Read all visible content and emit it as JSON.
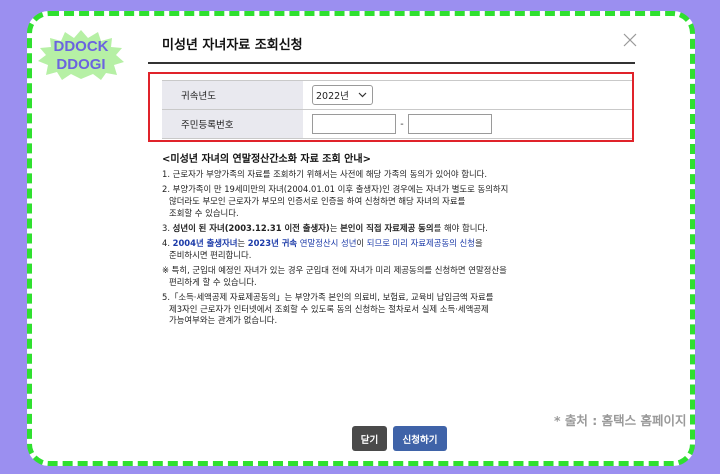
{
  "logo": {
    "line1": "DDOCK",
    "line2": "DDOGI"
  },
  "dialog": {
    "title": "미성년 자녀자료 조회신청",
    "close_icon": "close-icon"
  },
  "form": {
    "year_label": "귀속년도",
    "year_value": "2022년",
    "rrn_label": "주민등록번호",
    "rrn_front": "",
    "rrn_back": "",
    "rrn_separator": "-"
  },
  "info": {
    "heading": "<미성년 자녀의 연말정산간소화 자료 조회 안내>",
    "n1": "1. 근로자가 부양가족의 자료를 조회하기 위해서는 사전에 해당 가족의 동의가 있어야 합니다.",
    "n2a": "2. 부양가족이 만 19세미만의 자녀(2004.01.01 이후 출생자)인 경우에는 자녀가 별도로 동의하지",
    "n2b": "않더라도 부모인 근로자가 부모의 인증서로 인증을 하여 신청하면 해당 자녀의 자료를",
    "n2c": "조회할 수 있습니다.",
    "n3_p1": "3. ",
    "n3_b1": "성년이 된 자녀(2003.12.31 이전 출생자)",
    "n3_p2": "는 ",
    "n3_b2": "본인이 직접 자료제공 동의",
    "n3_p3": "를 해야 합니다.",
    "n4_p1": "4. ",
    "n4_b1": "2004년 출생자녀",
    "n4_p2": "는 ",
    "n4_b2": "2023년 귀속",
    "n4_p3": " 연말정산시 ",
    "n4_p4": "성년",
    "n4_p5": "이 ",
    "n4_p6": "되므로 미리 자료제공동의 신청",
    "n4_p7": "을",
    "n4b": "준비하시면 편리합니다.",
    "n5a": "※ 특히, 군입대 예정인 자녀가 있는 경우 군입대 전에 자녀가 미리 제공동의를 신청하면 연말정산을",
    "n5b": "편리하게 할 수 있습니다.",
    "n6a": "5.「소득·세액공제 자료제공동의」는 부양가족 본인의 의료비, 보험료, 교육비 납입금액 자료를",
    "n6b": "제3자인 근로자가 인터넷에서 조회할 수 있도록 동의 신청하는 절차로서 실제 소득·세액공제",
    "n6c": "가능여부와는 관계가 없습니다."
  },
  "source": "* 출처 : 홈택스 홈페이지",
  "buttons": {
    "close": "닫기",
    "apply": "신청하기"
  },
  "colors": {
    "background": "#9b8ff0",
    "dashed_border": "#2fe02f",
    "highlight_box": "#e0232a",
    "apply_button": "#3f63a8",
    "link_blue": "#1b3aa8"
  }
}
